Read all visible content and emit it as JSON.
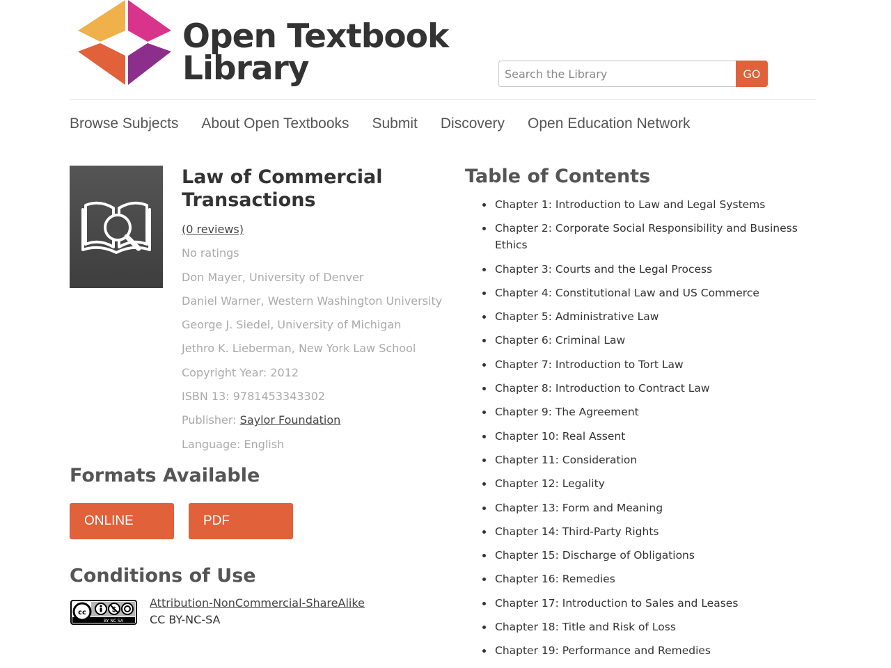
{
  "brand": {
    "line1": "Open Textbook",
    "line2": "Library"
  },
  "search": {
    "placeholder": "Search the Library",
    "button": "GO"
  },
  "nav": [
    "Browse Subjects",
    "About Open Textbooks",
    "Submit",
    "Discovery",
    "Open Education Network"
  ],
  "book": {
    "title": "Law of Commercial Transactions",
    "reviews": "(0 reviews)",
    "ratings": "No ratings",
    "authors": [
      "Don Mayer, University of Denver",
      "Daniel Warner, Western Washington University",
      "George J. Siedel, University of Michigan",
      "Jethro K. Lieberman, New York Law School"
    ],
    "copyright": "Copyright Year: 2012",
    "isbn": "ISBN 13: 9781453343302",
    "publisher_label": "Publisher: ",
    "publisher": "Saylor Foundation",
    "language": "Language: English"
  },
  "formats": {
    "title": "Formats Available",
    "online": "ONLINE",
    "pdf": "PDF"
  },
  "conditions": {
    "title": "Conditions of Use",
    "license_name": "Attribution-NonCommercial-ShareAlike",
    "license_code": "CC BY-NC-SA",
    "badge_text": "BY NC SA"
  },
  "toc": {
    "title": "Table of Contents",
    "chapters": [
      "Chapter 1: Introduction to Law and Legal Systems",
      "Chapter 2: Corporate Social Responsibility and Business Ethics",
      "Chapter 3: Courts and the Legal Process",
      "Chapter 4: Constitutional Law and US Commerce",
      "Chapter 5: Administrative Law",
      "Chapter 6: Criminal Law",
      "Chapter 7: Introduction to Tort Law",
      "Chapter 8: Introduction to Contract Law",
      "Chapter 9: The Agreement",
      "Chapter 10: Real Assent",
      "Chapter 11: Consideration",
      "Chapter 12: Legality",
      "Chapter 13: Form and Meaning",
      "Chapter 14: Third-Party Rights",
      "Chapter 15: Discharge of Obligations",
      "Chapter 16: Remedies",
      "Chapter 17: Introduction to Sales and Leases",
      "Chapter 18: Title and Risk of Loss",
      "Chapter 19: Performance and Remedies"
    ]
  },
  "colors": {
    "accent": "#e0613a",
    "text": "#333333",
    "muted": "#aaaaaa"
  }
}
